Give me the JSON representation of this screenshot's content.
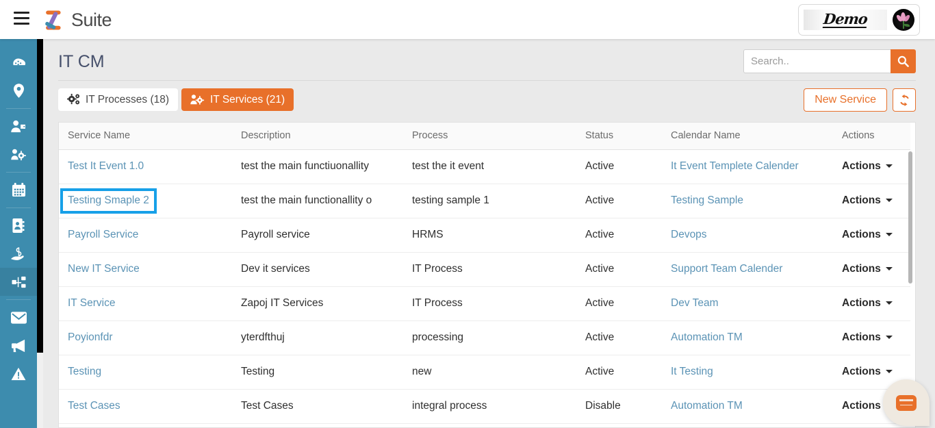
{
  "header": {
    "menu_icon": "hamburger-icon",
    "brand": "Suite",
    "account_logo_text": "Demo",
    "avatar_icon": "flower-avatar"
  },
  "sidebar": {
    "items": [
      {
        "name": "dashboard",
        "icon": "dashboard-gauge-icon",
        "active": false
      },
      {
        "name": "location",
        "icon": "map-pin-icon",
        "active": false
      },
      {
        "name": "user-tag",
        "icon": "user-tag-icon",
        "active": false
      },
      {
        "name": "users-cog",
        "icon": "users-cog-icon",
        "active": false
      },
      {
        "name": "calendar",
        "icon": "calendar-icon",
        "active": false
      },
      {
        "name": "address-book",
        "icon": "address-book-icon",
        "active": false
      },
      {
        "name": "hand-money",
        "icon": "hand-holding-usd-icon",
        "active": false
      },
      {
        "name": "sitemap",
        "icon": "sitemap-icon",
        "active": true
      },
      {
        "name": "mail",
        "icon": "envelope-icon",
        "active": false
      },
      {
        "name": "announcements",
        "icon": "bullhorn-icon",
        "active": false
      },
      {
        "name": "alerts",
        "icon": "warning-triangle-icon",
        "active": false
      }
    ]
  },
  "page": {
    "title": "IT CM"
  },
  "search": {
    "placeholder": "Search..",
    "value": "",
    "button_icon": "search-icon"
  },
  "tabs": [
    {
      "label": "IT Processes (18)",
      "icon": "cogs-icon",
      "active": false
    },
    {
      "label": "IT Services (21)",
      "icon": "users-cog-icon",
      "active": true
    }
  ],
  "toolbar": {
    "new_service_label": "New Service",
    "refresh_icon": "sync-icon"
  },
  "table": {
    "columns": [
      "Service Name",
      "Description",
      "Process",
      "Status",
      "Calendar Name",
      "Actions"
    ],
    "action_label": "Actions",
    "rows": [
      {
        "service_name": "Test It Event 1.0",
        "description": "test the main functiuonallity",
        "process": "test the it event",
        "status": "Active",
        "calendar_name": "It Event Templete Calender",
        "highlighted": false
      },
      {
        "service_name": "Testing Smaple 2",
        "description": "test the main functionallity o",
        "process": "testing sample 1",
        "status": "Active",
        "calendar_name": "Testing Sample",
        "highlighted": true
      },
      {
        "service_name": "Payroll Service",
        "description": "Payroll service",
        "process": "HRMS",
        "status": "Active",
        "calendar_name": "Devops",
        "highlighted": false
      },
      {
        "service_name": "New IT Service",
        "description": "Dev it services",
        "process": "IT Process",
        "status": "Active",
        "calendar_name": "Support Team Calender",
        "highlighted": false
      },
      {
        "service_name": "IT Service",
        "description": "Zapoj IT Services",
        "process": "IT Process",
        "status": "Active",
        "calendar_name": "Dev Team",
        "highlighted": false
      },
      {
        "service_name": "Poyionfdr",
        "description": "yterdfthuj",
        "process": "processing",
        "status": "Active",
        "calendar_name": "Automation TM",
        "highlighted": false
      },
      {
        "service_name": "Testing",
        "description": "Testing",
        "process": "new",
        "status": "Active",
        "calendar_name": "It Testing",
        "highlighted": false
      },
      {
        "service_name": "Test Cases",
        "description": "Test Cases",
        "process": "integral process",
        "status": "Disable",
        "calendar_name": "Automation TM",
        "highlighted": false
      }
    ]
  },
  "chat": {
    "icon": "chat-bubble-icon"
  },
  "colors": {
    "accent_orange": "#e8702a",
    "sidebar_blue": "#3d8cae",
    "link_blue": "#5b93b5",
    "highlight_blue": "#17a0e8"
  }
}
